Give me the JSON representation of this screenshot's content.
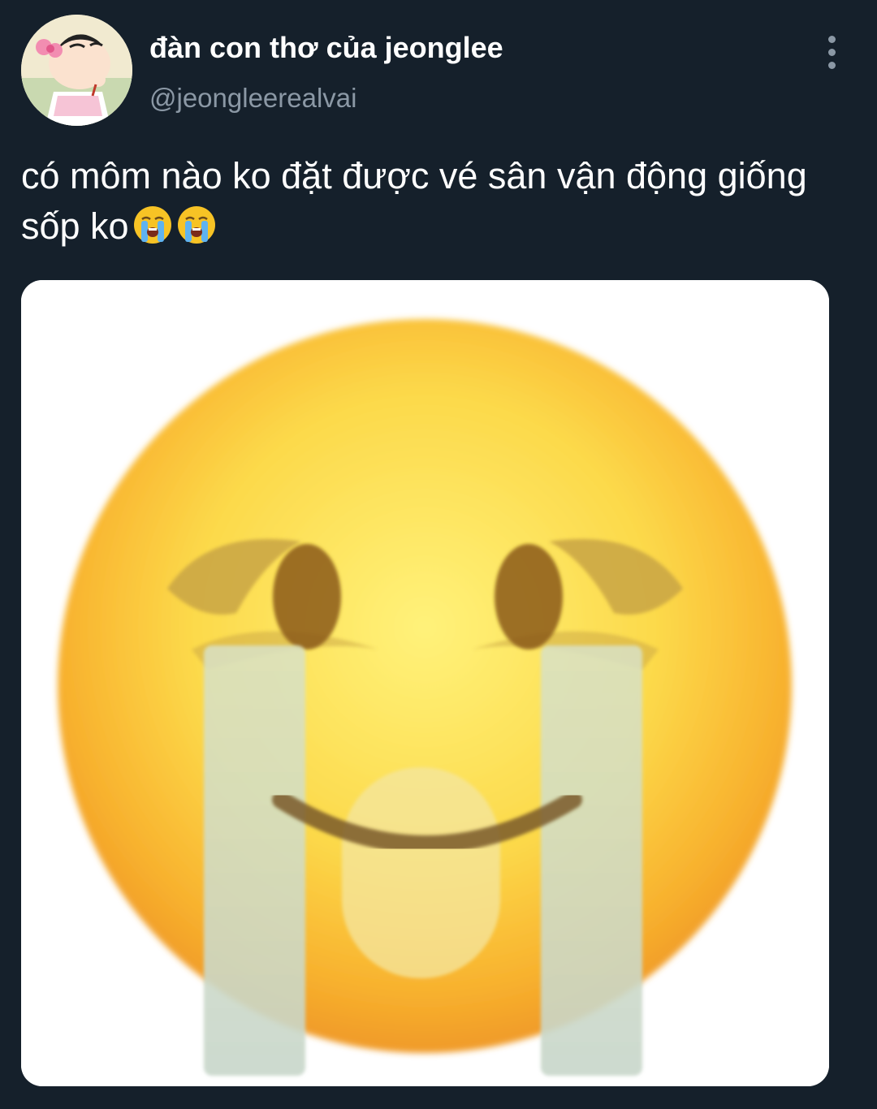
{
  "tweet": {
    "author": {
      "display_name": "đàn con thơ của jeonglee",
      "handle": "@jeongleerealvai"
    },
    "text": "có môm nào ko đặt được vé sân vận động giống sốp ko",
    "text_emojis": [
      "loudly-crying-face",
      "loudly-crying-face"
    ],
    "media": {
      "icon": "crying-smiling-face-emoji"
    }
  },
  "colors": {
    "background": "#15202b",
    "handle": "#8b98a5",
    "text": "#ffffff",
    "media_background": "#ffffff"
  }
}
